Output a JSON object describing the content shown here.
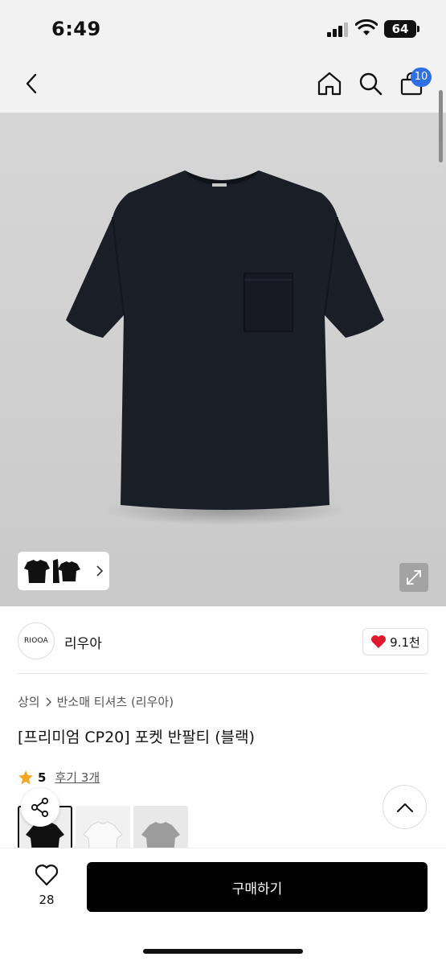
{
  "status_bar": {
    "time": "6:49",
    "battery": "64"
  },
  "header": {
    "cart_count": "10"
  },
  "brand": {
    "logo_text": "RIOOA",
    "name": "리우아",
    "likes": "9.1천"
  },
  "breadcrumb": {
    "category": "상의",
    "subcategory": "반소매 티셔츠 (리우아)"
  },
  "product": {
    "title": "[프리미엄 CP20] 포켓 반팔티 (블랙)",
    "rating": "5",
    "reviews": "후기 3개"
  },
  "colors": {
    "accent": "#2f6fe4",
    "heart": "#e0192f",
    "star": "#f5a623"
  },
  "bottom_bar": {
    "wish_count": "28",
    "buy_label": "구매하기"
  }
}
